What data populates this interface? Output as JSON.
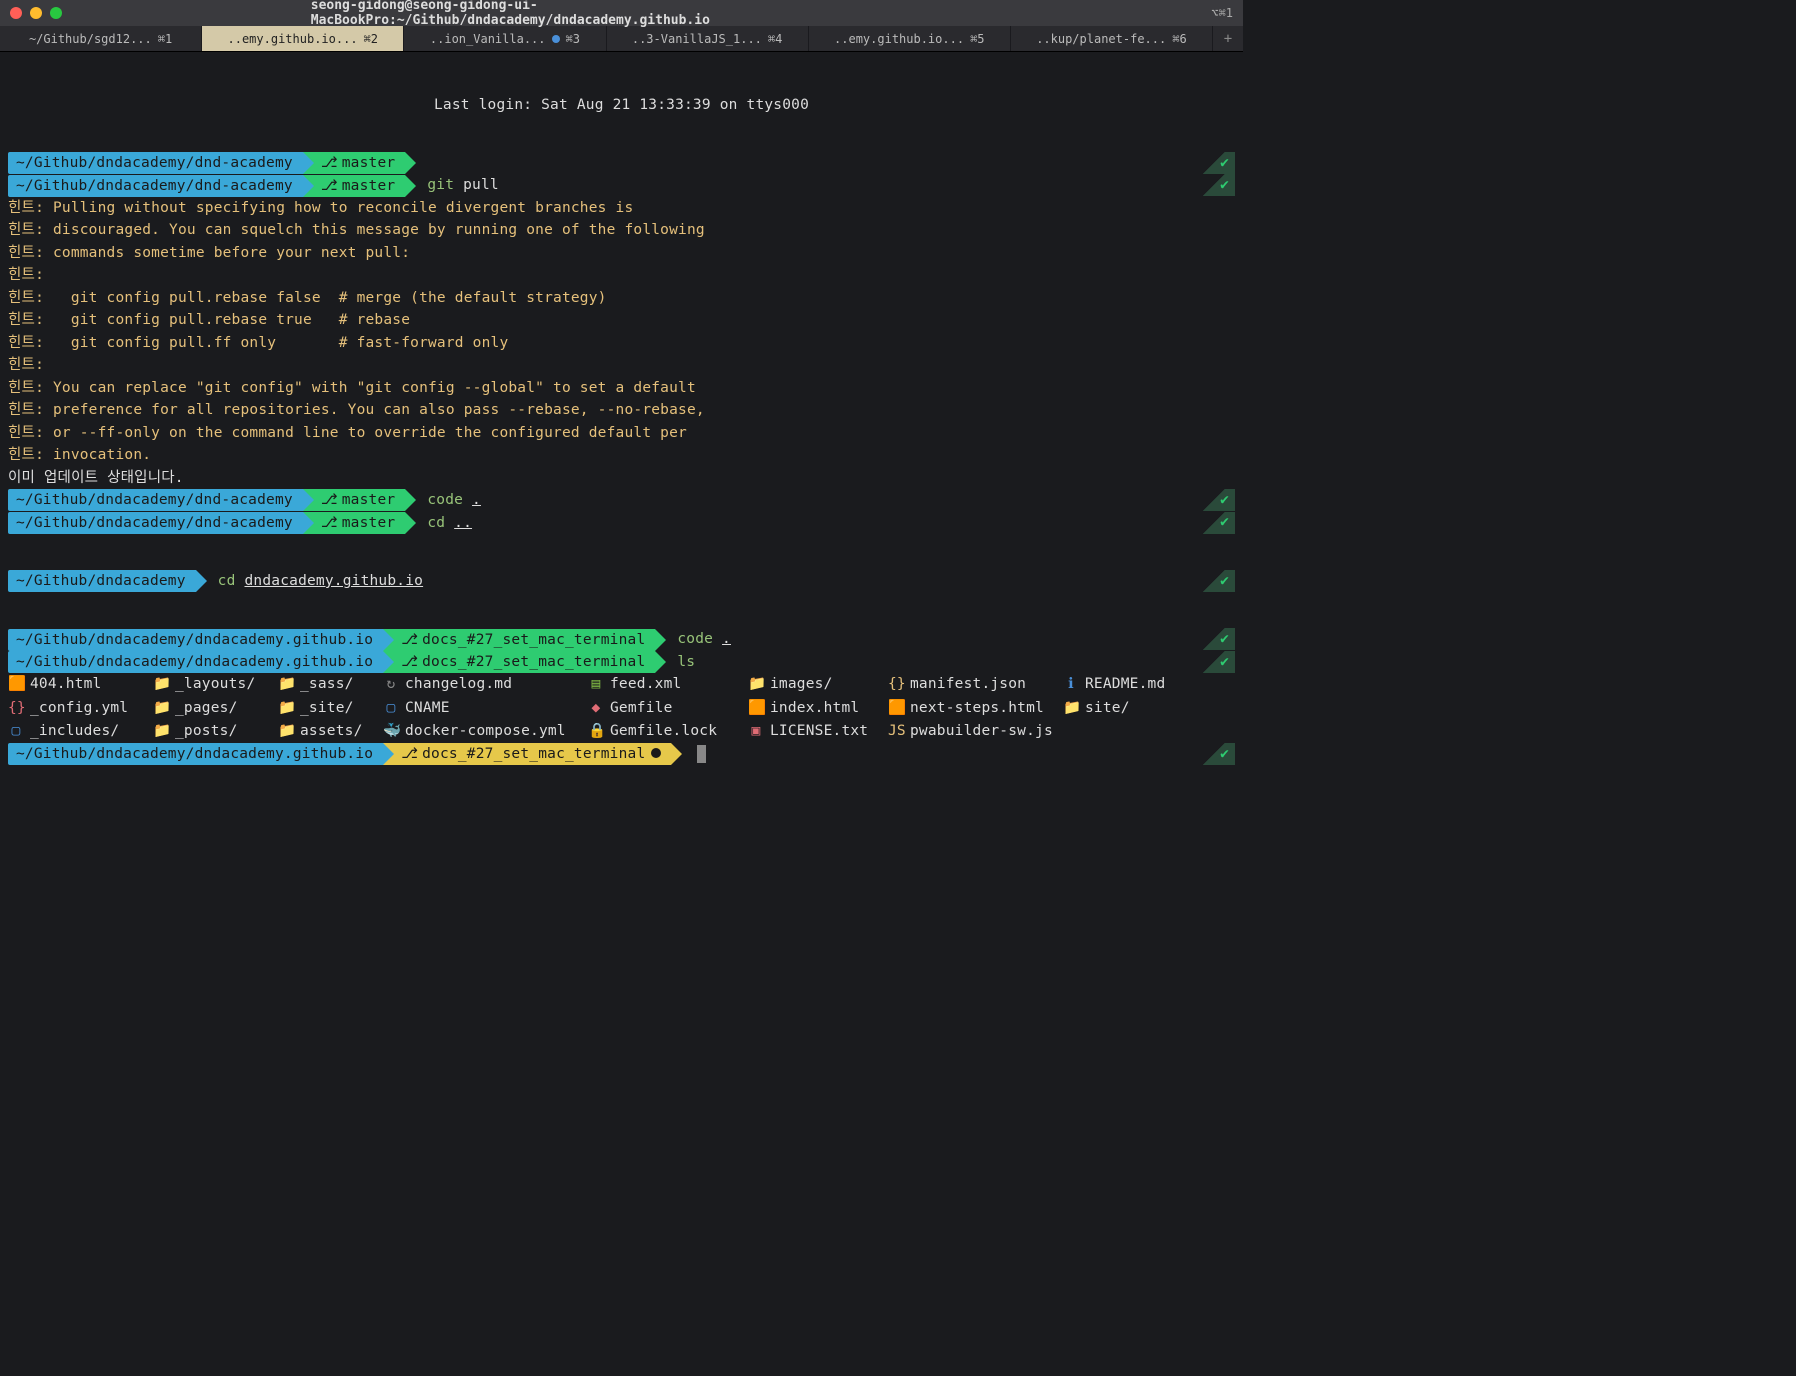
{
  "titlebar": {
    "title": "seong-gidong@seong-gidong-ui-MacBookPro:~/Github/dndacademy/dndacademy.github.io",
    "right": "⌥⌘1"
  },
  "tabs": [
    {
      "label": "~/Github/sgd12...",
      "shortcut": "⌘1",
      "active": false,
      "dirty": false
    },
    {
      "label": "..emy.github.io...",
      "shortcut": "⌘2",
      "active": true,
      "dirty": false
    },
    {
      "label": "..ion_Vanilla...",
      "shortcut": "⌘3",
      "active": false,
      "dirty": true
    },
    {
      "label": "..3-VanillaJS_1...",
      "shortcut": "⌘4",
      "active": false,
      "dirty": false
    },
    {
      "label": "..emy.github.io...",
      "shortcut": "⌘5",
      "active": false,
      "dirty": false
    },
    {
      "label": "..kup/planet-fe...",
      "shortcut": "⌘6",
      "active": false,
      "dirty": false
    }
  ],
  "login_line": "Last login: Sat Aug 21 13:33:39 on ttys000",
  "prompts": {
    "path_academy": "~/Github/dndacademy/dnd-academy",
    "path_dndacademy": "~/Github/dndacademy",
    "path_githubio": "~/Github/dndacademy/dndacademy.github.io",
    "branch_master": "master",
    "branch_docs": "docs_#27_set_mac_terminal"
  },
  "cmds": {
    "git": "git",
    "pull": "pull",
    "code": "code",
    "dot": ".",
    "cd": "cd",
    "dotdot": "..",
    "ls": "ls",
    "cd_target": "dndacademy.github.io"
  },
  "hints": {
    "prefix": "힌트:",
    "l1": "Pulling without specifying how to reconcile divergent branches is",
    "l2": "discouraged. You can squelch this message by running one of the following",
    "l3": "commands sometime before your next pull:",
    "l4": "",
    "l5": "  git config pull.rebase false  # merge (the default strategy)",
    "l6": "  git config pull.rebase true   # rebase",
    "l7": "  git config pull.ff only       # fast-forward only",
    "l8": "",
    "l9": "You can replace \"git config\" with \"git config --global\" to set a default",
    "l10": "preference for all repositories. You can also pass --rebase, --no-rebase,",
    "l11": "or --ff-only on the command line to override the configured default per",
    "l12": "invocation."
  },
  "already_updated": "이미 업데이트 상태입니다.",
  "ls": [
    {
      "icon": "🟧",
      "cls": "i-html",
      "name": "404.html"
    },
    {
      "icon": "📁",
      "cls": "i-folder",
      "name": "_layouts/"
    },
    {
      "icon": "📁",
      "cls": "i-folder",
      "name": "_sass/"
    },
    {
      "icon": "↻",
      "cls": "i-reload",
      "name": "changelog.md"
    },
    {
      "icon": "▤",
      "cls": "i-xml",
      "name": "feed.xml"
    },
    {
      "icon": "📁",
      "cls": "i-folder",
      "name": "images/"
    },
    {
      "icon": "{}",
      "cls": "i-json",
      "name": "manifest.json"
    },
    {
      "icon": "ℹ",
      "cls": "i-info",
      "name": "README.md"
    },
    {
      "icon": "{}",
      "cls": "i-config",
      "name": "_config.yml"
    },
    {
      "icon": "📁",
      "cls": "i-folder",
      "name": "_pages/"
    },
    {
      "icon": "📁",
      "cls": "i-folder",
      "name": "_site/"
    },
    {
      "icon": "▢",
      "cls": "i-css",
      "name": "CNAME"
    },
    {
      "icon": "◆",
      "cls": "i-gem",
      "name": "Gemfile"
    },
    {
      "icon": "🟧",
      "cls": "i-html",
      "name": "index.html"
    },
    {
      "icon": "🟧",
      "cls": "i-html",
      "name": "next-steps.html"
    },
    {
      "icon": "📁",
      "cls": "i-folder",
      "name": "site/"
    },
    {
      "icon": "▢",
      "cls": "i-css",
      "name": "_includes/"
    },
    {
      "icon": "📁",
      "cls": "i-folder",
      "name": "_posts/"
    },
    {
      "icon": "📁",
      "cls": "i-folder",
      "name": "assets/"
    },
    {
      "icon": "🐳",
      "cls": "i-docker",
      "name": "docker-compose.yml"
    },
    {
      "icon": "🔒",
      "cls": "i-lock",
      "name": "Gemfile.lock"
    },
    {
      "icon": "▣",
      "cls": "i-lic",
      "name": "LICENSE.txt"
    },
    {
      "icon": "JS",
      "cls": "i-js",
      "name": "pwabuilder-sw.js"
    }
  ]
}
